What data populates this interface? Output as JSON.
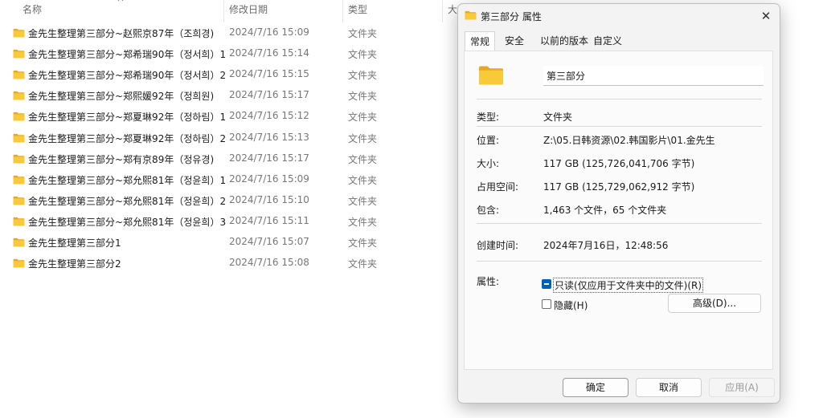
{
  "explorer": {
    "columns": {
      "name": "名称",
      "modified": "修改日期",
      "type": "类型",
      "size": "大"
    },
    "rows": [
      {
        "name": "金先生整理第三部分~赵熙京87年（조희경)",
        "modified": "2024/7/16 15:09",
        "type": "文件夹"
      },
      {
        "name": "金先生整理第三部分~郑希瑞90年（정서희）1",
        "modified": "2024/7/16 15:14",
        "type": "文件夹"
      },
      {
        "name": "金先生整理第三部分~郑希瑞90年（정서희）2",
        "modified": "2024/7/16 15:15",
        "type": "文件夹"
      },
      {
        "name": "金先生整理第三部分~郑熙媛92年（정희원)",
        "modified": "2024/7/16 15:17",
        "type": "文件夹"
      },
      {
        "name": "金先生整理第三部分~郑夏琳92年（정하림）1",
        "modified": "2024/7/16 15:12",
        "type": "文件夹"
      },
      {
        "name": "金先生整理第三部分~郑夏琳92年（정하림）2",
        "modified": "2024/7/16 15:13",
        "type": "文件夹"
      },
      {
        "name": "金先生整理第三部分~郑有京89年（정유경)",
        "modified": "2024/7/16 15:17",
        "type": "文件夹"
      },
      {
        "name": "金先生整理第三部分~郑允熙81年（정윤희）1",
        "modified": "2024/7/16 15:09",
        "type": "文件夹"
      },
      {
        "name": "金先生整理第三部分~郑允熙81年（정윤희）2",
        "modified": "2024/7/16 15:10",
        "type": "文件夹"
      },
      {
        "name": "金先生整理第三部分~郑允熙81年（정윤희）3",
        "modified": "2024/7/16 15:11",
        "type": "文件夹"
      },
      {
        "name": "金先生整理第三部分1",
        "modified": "2024/7/16 15:07",
        "type": "文件夹"
      },
      {
        "name": "金先生整理第三部分2",
        "modified": "2024/7/16 15:08",
        "type": "文件夹"
      }
    ]
  },
  "dialog": {
    "title": "第三部分 属性",
    "close_glyph": "✕",
    "tabs": [
      {
        "label": "常规",
        "active": true
      },
      {
        "label": "安全",
        "active": false
      },
      {
        "label": "以前的版本",
        "active": false
      },
      {
        "label": "自定义",
        "active": false
      }
    ],
    "folder_name": "第三部分",
    "props": {
      "type": {
        "label": "类型:",
        "value": "文件夹"
      },
      "location": {
        "label": "位置:",
        "value": "Z:\\05.日韩资源\\02.韩国影片\\01.金先生"
      },
      "size": {
        "label": "大小:",
        "value": "117 GB (125,726,041,706 字节)"
      },
      "size_on_disk": {
        "label": "占用空间:",
        "value": "117 GB (125,729,062,912 字节)"
      },
      "contains": {
        "label": "包含:",
        "value": "1,463 个文件，65 个文件夹"
      },
      "created": {
        "label": "创建时间:",
        "value": "2024年7月16日，12:48:56"
      }
    },
    "attributes": {
      "label": "属性:",
      "readonly": {
        "label": "只读(仅应用于文件夹中的文件)(R)",
        "state": "indeterminate"
      },
      "hidden": {
        "label": "隐藏(H)",
        "state": "unchecked"
      },
      "advanced_label": "高级(D)..."
    },
    "buttons": {
      "ok": "确定",
      "cancel": "取消",
      "apply": "应用(A)"
    }
  },
  "colors": {
    "accent": "#005fb8",
    "folder_yellow": "#f8c938",
    "folder_shade": "#e8a922"
  },
  "icons": {
    "folder": "folder-icon",
    "close": "close-icon",
    "sort": "sort-up-icon"
  }
}
